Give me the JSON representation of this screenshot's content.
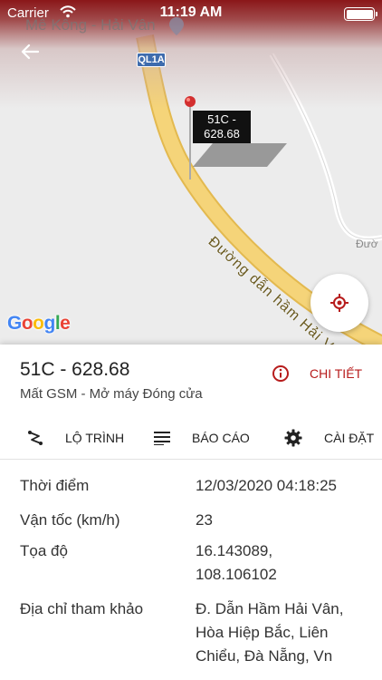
{
  "status_bar": {
    "carrier": "Carrier",
    "time": "11:19 AM"
  },
  "map": {
    "place_label": "Mê Kông - Hải Vân",
    "highway_shield": "QL1A",
    "road_label": "Đường dẫn hầm Hải Vân",
    "side_road_label": "Đườ",
    "marker": {
      "plate_line1": "51C -",
      "plate_line2": "628.68"
    },
    "google_logo": [
      "G",
      "o",
      "o",
      "g",
      "l",
      "e"
    ]
  },
  "colors": {
    "accent": "#b71c1c",
    "header_dark": "#8a1719",
    "highway": "#f5d479"
  },
  "icons": {
    "back": "arrow-left-icon",
    "locate": "gps-target-icon",
    "detail": "info-circle-icon",
    "route": "route-icon",
    "report": "list-icon",
    "settings": "gear-icon"
  },
  "vehicle": {
    "plate": "51C - 628.68",
    "status": "Mất GSM - Mở máy Đóng cửa",
    "detail_label": "CHI TIẾT"
  },
  "actions": [
    {
      "label": "LỘ TRÌNH"
    },
    {
      "label": "BÁO CÁO"
    },
    {
      "label": "CÀI ĐẶT"
    }
  ],
  "info": [
    {
      "key": "Thời điểm",
      "value": "12/03/2020 04:18:25"
    },
    {
      "key": "Vận tốc (km/h)",
      "value": "23"
    },
    {
      "key": "Tọa độ",
      "value": "16.143089, 108.106102"
    },
    {
      "key": "Địa chỉ tham khảo",
      "value": "Đ. Dẫn Hầm Hải Vân, Hòa Hiệp Bắc, Liên Chiểu, Đà Nẵng, Vn"
    }
  ]
}
